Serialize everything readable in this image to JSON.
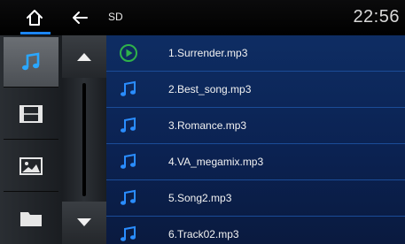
{
  "header": {
    "path": "SD",
    "clock": "22:56"
  },
  "sidebar": {
    "items": [
      {
        "icon": "music-note-icon",
        "active": true
      },
      {
        "icon": "film-icon",
        "active": false
      },
      {
        "icon": "picture-icon",
        "active": false
      },
      {
        "icon": "folder-icon",
        "active": false
      }
    ]
  },
  "files": [
    {
      "name": "1.Surrender.mp3",
      "icon": "play-circle-icon",
      "playing": true
    },
    {
      "name": "2.Best_song.mp3",
      "icon": "music-note-icon",
      "playing": false
    },
    {
      "name": "3.Romance.mp3",
      "icon": "music-note-icon",
      "playing": false
    },
    {
      "name": "4.VA_megamix.mp3",
      "icon": "music-note-icon",
      "playing": false
    },
    {
      "name": "5.Song2.mp3",
      "icon": "music-note-icon",
      "playing": false
    },
    {
      "name": "6.Track02.mp3",
      "icon": "music-note-icon",
      "playing": false
    }
  ],
  "colors": {
    "accent": "#1c86ff",
    "list_background": "#0e2d63",
    "playing_icon": "#2fb24a"
  }
}
